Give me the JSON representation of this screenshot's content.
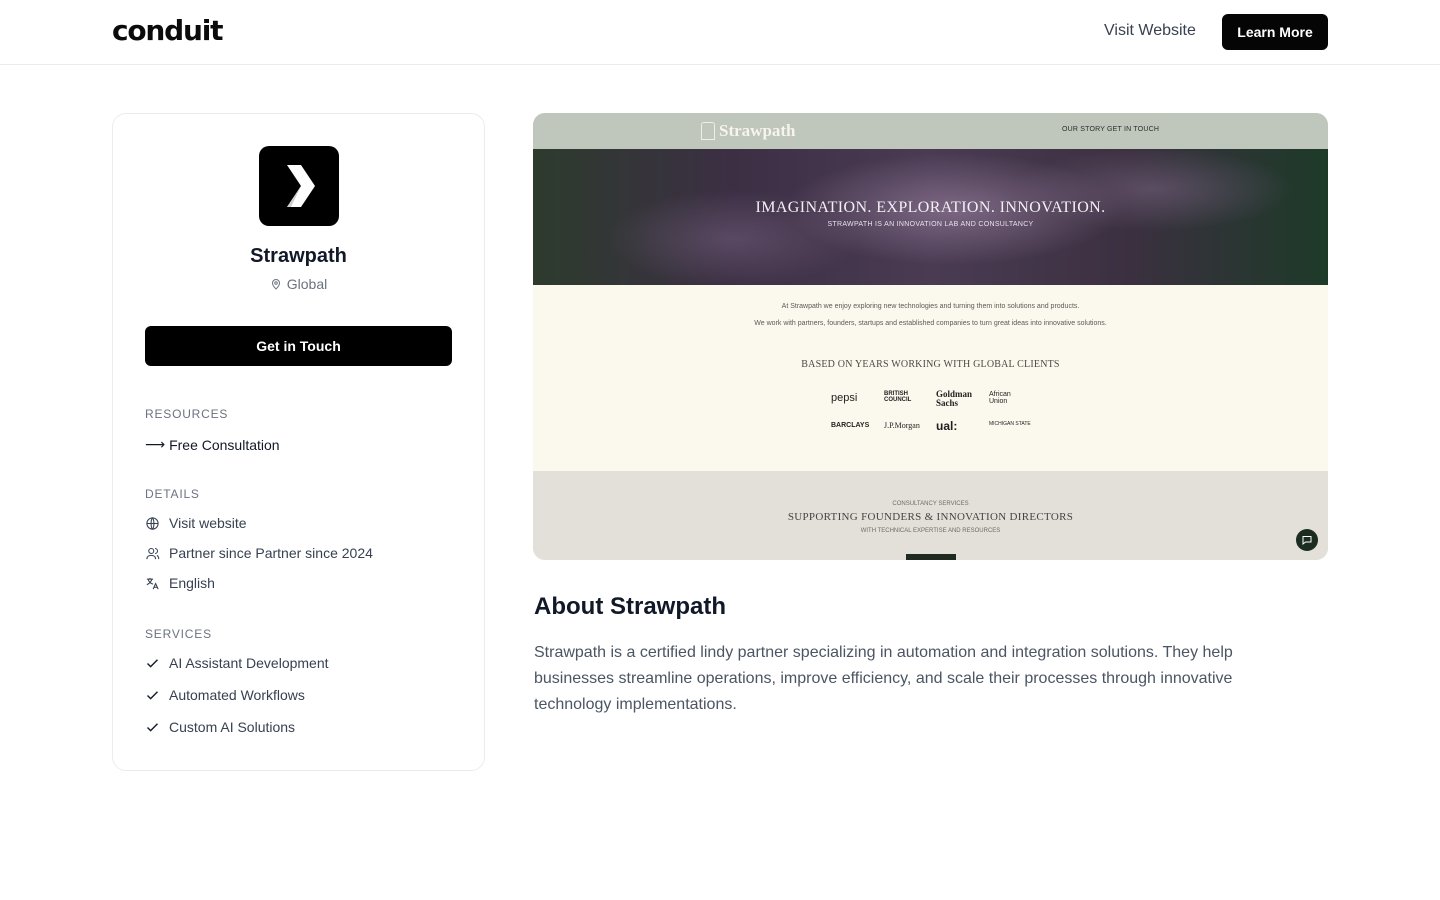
{
  "header": {
    "logo": "conduit",
    "visit_website": "Visit Website",
    "learn_more": "Learn More"
  },
  "profile": {
    "name": "Strawpath",
    "location": "Global",
    "cta": "Get in Touch",
    "resources": {
      "title": "RESOURCES",
      "items": [
        {
          "label": "Free Consultation",
          "arrow": "⟶"
        }
      ]
    },
    "details": {
      "title": "DETAILS",
      "items": [
        {
          "label": "Visit website",
          "icon": "globe-icon"
        },
        {
          "label": "Partner since Partner since 2024",
          "icon": "users-icon"
        },
        {
          "label": "English",
          "icon": "translate-icon"
        }
      ]
    },
    "services": {
      "title": "SERVICES",
      "items": [
        {
          "label": "AI Assistant Development",
          "icon": "check-icon"
        },
        {
          "label": "Automated Workflows",
          "icon": "check-icon"
        },
        {
          "label": "Custom AI Solutions",
          "icon": "check-icon"
        }
      ]
    }
  },
  "preview": {
    "brand": "Strawpath",
    "menu": [
      "OUR STORY",
      "GET IN TOUCH"
    ],
    "hero_title": "IMAGINATION. EXPLORATION. INNOVATION.",
    "hero_sub": "STRAWPATH IS AN INNOVATION LAB AND CONSULTANCY",
    "intro_1": "At Strawpath we enjoy exploring new technologies and turning them into solutions and products.",
    "intro_2": "We work with partners, founders, startups and established companies to turn great ideas into innovative solutions.",
    "clients_title": "BASED ON YEARS WORKING WITH GLOBAL CLIENTS",
    "clients": [
      "pepsi",
      "BRITISH COUNCIL",
      "Goldman Sachs",
      "African Union",
      "BARCLAYS",
      "J.P.Morgan",
      "ual:",
      "MICHIGAN STATE"
    ],
    "footer_kicker": "CONSULTANCY SERVICES",
    "footer_title": "SUPPORTING FOUNDERS & INNOVATION DIRECTORS",
    "footer_sub": "WITH TECHNICAL EXPERTISE AND RESOURCES"
  },
  "about": {
    "title": "About Strawpath",
    "text": "Strawpath is a certified lindy partner specializing in automation and integration solutions. They help businesses streamline operations, improve efficiency, and scale their processes through innovative technology implementations."
  }
}
